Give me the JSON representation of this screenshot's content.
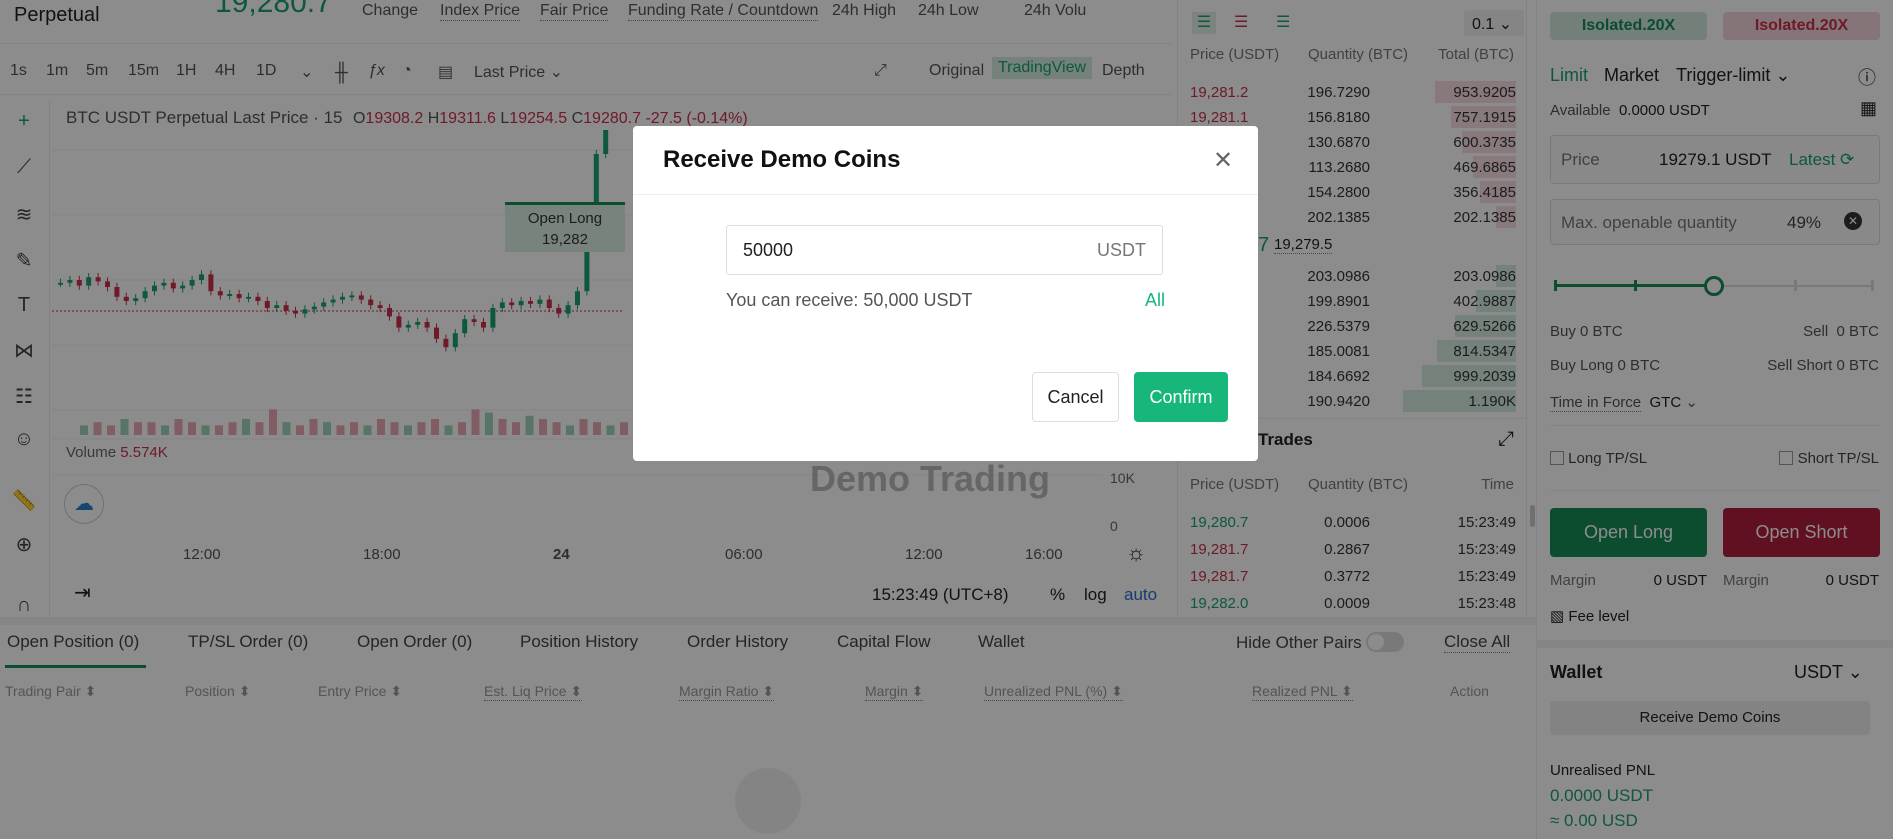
{
  "header": {
    "symbol": "Perpetual",
    "last_price": "19,280.7",
    "stats": [
      "Change",
      "Index Price",
      "Fair Price",
      "Funding Rate / Countdown",
      "24h High",
      "24h Low",
      "24h Volu"
    ]
  },
  "toolbar": {
    "intervals": [
      "1s",
      "1m",
      "5m",
      "15m",
      "1H",
      "4H",
      "1D"
    ],
    "active_interval": "15m",
    "price_type": "Last Price",
    "views": [
      "Original",
      "TradingView",
      "Depth"
    ],
    "active_view": "TradingView"
  },
  "chart": {
    "legend_title": "BTC USDT Perpetual Last Price · 15",
    "o": "19308.2",
    "h": "19311.6",
    "l": "19254.5",
    "c": "19280.7",
    "chg": "-27.5 (-0.14%)",
    "open_long_tag": "Open Long",
    "open_long_price": "19,282",
    "volume_label": "Volume",
    "volume_value": "5.574K",
    "watermark": "Demo Trading",
    "vol_ticks": [
      "10K",
      "0"
    ],
    "x_ticks": [
      "12:00",
      "18:00",
      "24",
      "06:00",
      "12:00",
      "16:00"
    ],
    "time": "15:23:49 (UTC+8)",
    "pct": "%",
    "log": "log",
    "auto": "auto",
    "closes": [
      19268,
      19270,
      19266,
      19272,
      19269,
      19265,
      19258,
      19255,
      19257,
      19262,
      19266,
      19268,
      19264,
      19266,
      19270,
      19274,
      19262,
      19259,
      19260,
      19257,
      19258,
      19255,
      19250,
      19252,
      19248,
      19246,
      19249,
      19251,
      19254,
      19256,
      19258,
      19259,
      19256,
      19252,
      19250,
      19244,
      19236,
      19238,
      19240,
      19236,
      19228,
      19222,
      19232,
      19242,
      19240,
      19236,
      19250,
      19254,
      19252,
      19255,
      19253,
      19256,
      19250,
      19246,
      19252,
      19262,
      19300,
      19360,
      19420
    ],
    "volumes": [
      3,
      4,
      3,
      5,
      4,
      4,
      3,
      5,
      4,
      3,
      3,
      4,
      5,
      4,
      8,
      4,
      3,
      5,
      4,
      3,
      4,
      3,
      5,
      4,
      3,
      4,
      5,
      3,
      4,
      8,
      7,
      5,
      4,
      6,
      5,
      4,
      3,
      5,
      4,
      3,
      4,
      5,
      7,
      9,
      30,
      20,
      16,
      12,
      10,
      6,
      8,
      12,
      9,
      15,
      22,
      18,
      12,
      10,
      14,
      11,
      8,
      12
    ]
  },
  "orderbook": {
    "step": "0.1",
    "headers": [
      "Price (USDT)",
      "Quantity (BTC)",
      "Total (BTC)"
    ],
    "asks": [
      {
        "p": "19,281.2",
        "q": "196.7290",
        "t": "953.9205",
        "d": 0.45
      },
      {
        "p": "19,281.1",
        "q": "156.8180",
        "t": "757.1915",
        "d": 0.36
      },
      {
        "p": "",
        "q": "130.6870",
        "t": "600.3735",
        "d": 0.3
      },
      {
        "p": "",
        "q": "113.2680",
        "t": "469.6865",
        "d": 0.24
      },
      {
        "p": "",
        "q": "154.2800",
        "t": "356.4185",
        "d": 0.2
      },
      {
        "p": "",
        "q": "202.1385",
        "t": "202.1385",
        "d": 0.11
      }
    ],
    "mid_last": "7",
    "mid_mark": "19,279.5",
    "bids": [
      {
        "q": "203.0986",
        "t": "203.0986",
        "d": 0.11
      },
      {
        "q": "199.8901",
        "t": "402.9887",
        "d": 0.22
      },
      {
        "q": "226.5379",
        "t": "629.5266",
        "d": 0.34
      },
      {
        "q": "185.0081",
        "t": "814.5347",
        "d": 0.44
      },
      {
        "q": "184.6692",
        "t": "999.2039",
        "d": 0.52
      },
      {
        "q": "190.9420",
        "t": "1.190K",
        "d": 0.63
      }
    ]
  },
  "trades": {
    "title": "Trades",
    "headers": [
      "Price (USDT)",
      "Quantity (BTC)",
      "Time"
    ],
    "rows": [
      {
        "p": "19,280.7",
        "q": "0.0006",
        "t": "15:23:49",
        "side": "buy"
      },
      {
        "p": "19,281.7",
        "q": "0.2867",
        "t": "15:23:49",
        "side": "sell"
      },
      {
        "p": "19,281.7",
        "q": "0.3772",
        "t": "15:23:49",
        "side": "sell"
      },
      {
        "p": "19,282.0",
        "q": "0.0009",
        "t": "15:23:48",
        "side": "buy"
      }
    ]
  },
  "order_panel": {
    "margin_long": "Isolated.20X",
    "margin_short": "Isolated.20X",
    "tabs": [
      "Limit",
      "Market",
      "Trigger-limit"
    ],
    "available_label": "Available",
    "available": "0.0000 USDT",
    "price_label": "Price",
    "price": "19279.1 USDT",
    "latest": "Latest",
    "qty_label": "Max. openable quantity",
    "qty_pct": "49%",
    "slider_value": 0.5,
    "buy": "Buy 0 BTC",
    "sell": "Sell  0 BTC",
    "buy_long": "Buy Long 0 BTC",
    "sell_short": "Sell Short 0 BTC",
    "tif_label": "Time in Force",
    "tif": "GTC",
    "long_tpsl": "Long TP/SL",
    "short_tpsl": "Short TP/SL",
    "open_long": "Open Long",
    "open_short": "Open Short",
    "margin_label": "Margin",
    "margin_long_val": "0 USDT",
    "margin_short_val": "0 USDT",
    "fee_level": "Fee level"
  },
  "wallet": {
    "title": "Wallet",
    "currency": "USDT",
    "receive": "Receive Demo Coins",
    "unrealised_label": "Unrealised PNL",
    "unrealised": "0.0000 USDT",
    "usd": "≈ 0.00 USD"
  },
  "bottom": {
    "tabs": [
      "Open Position (0)",
      "TP/SL Order (0)",
      "Open Order (0)",
      "Position History",
      "Order History",
      "Capital Flow",
      "Wallet"
    ],
    "hide_other": "Hide Other Pairs",
    "close_all": "Close All",
    "columns": [
      "Trading Pair ⬍",
      "Position ⬍",
      "Entry Price ⬍",
      "Est. Liq Price ⬍",
      "Margin Ratio ⬍",
      "Margin ⬍",
      "Unrealized PNL (%) ⬍",
      "Realized PNL ⬍",
      "Action"
    ]
  },
  "modal": {
    "title": "Receive Demo Coins",
    "amount": "50000",
    "unit": "USDT",
    "hint": "You can receive: 50,000 USDT",
    "all": "All",
    "cancel": "Cancel",
    "confirm": "Confirm"
  },
  "colors": {
    "green": "#1aa06d",
    "red": "#c8304a",
    "confirm": "#17b67a",
    "open_long": "#168a57",
    "open_short": "#b01e3c"
  }
}
